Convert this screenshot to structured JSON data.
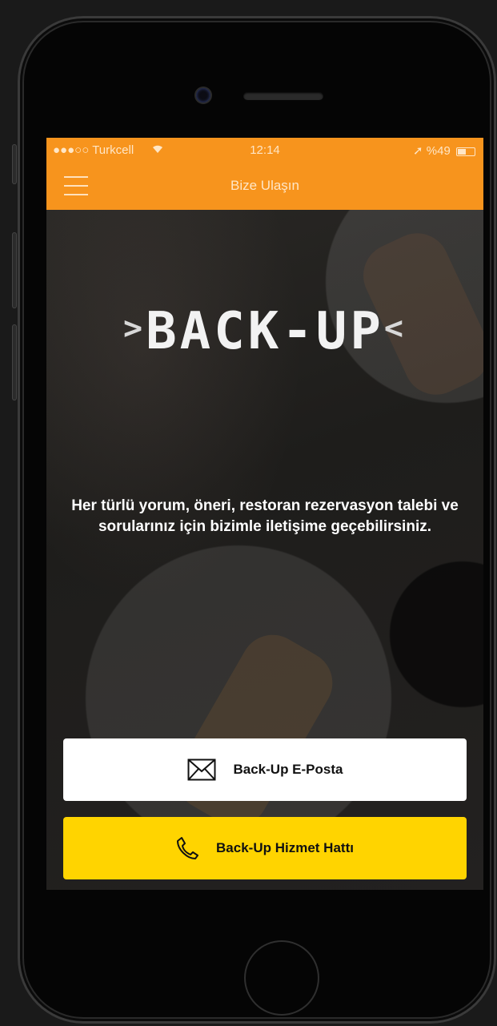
{
  "status_bar": {
    "carrier": "●●●○○ Turkcell",
    "wifi_icon": "wifi-icon",
    "time": "12:14",
    "battery_percent": "%49"
  },
  "navbar": {
    "title": "Bize Ulaşın",
    "menu_icon": "hamburger-icon"
  },
  "logo": {
    "text": "BACK-UP"
  },
  "description": "Her türlü yorum, öneri, restoran rezervasyon talebi ve sorularınız için bizimle iletişime geçebilirsiniz.",
  "buttons": {
    "email_label": "Back-Up E-Posta",
    "email_icon": "envelope-icon",
    "phone_label": "Back-Up Hizmet Hattı",
    "phone_icon": "phone-icon"
  },
  "colors": {
    "accent_orange": "#f7941d",
    "phone_button_yellow": "#ffd400",
    "email_button_white": "#ffffff"
  }
}
